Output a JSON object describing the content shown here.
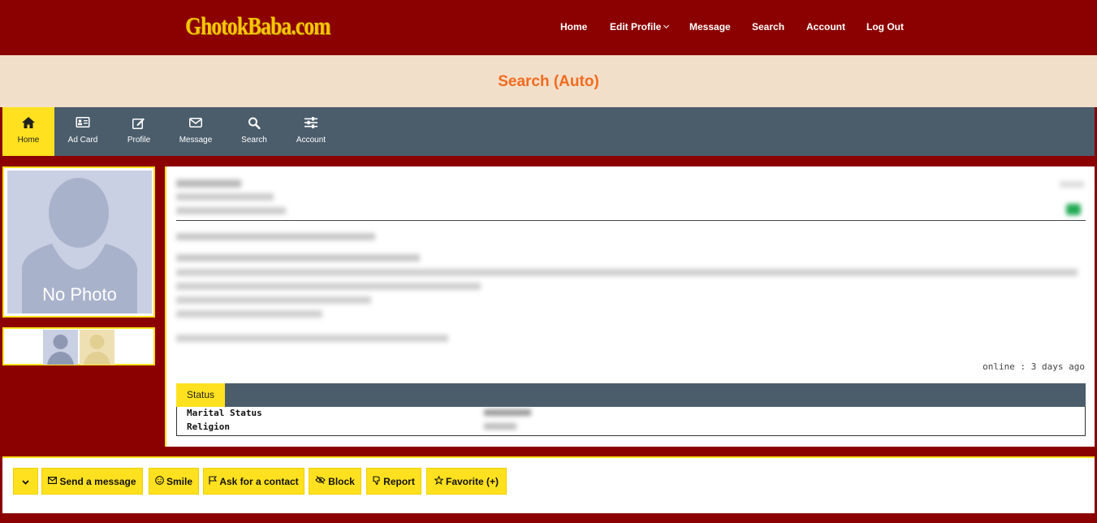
{
  "brand": {
    "logo": "GhotokBaba.com"
  },
  "nav": {
    "home": "Home",
    "edit_profile": "Edit Profile",
    "message": "Message",
    "search": "Search",
    "account": "Account",
    "logout": "Log Out"
  },
  "page": {
    "title": "Search (Auto)"
  },
  "menu": {
    "home": "Home",
    "ad_card": "Ad Card",
    "profile": "Profile",
    "message": "Message",
    "search": "Search",
    "account": "Account"
  },
  "photo": {
    "no_photo": "No Photo"
  },
  "profile": {
    "online": "online : 3 days ago"
  },
  "status": {
    "tab": "Status",
    "marital_label": "Marital Status",
    "religion_label": "Religion"
  },
  "actions": {
    "send_message": "Send a message",
    "smile": "Smile",
    "ask_contact": "Ask for a contact",
    "block": "Block",
    "report": "Report",
    "favorite": "Favorite (+)"
  },
  "colors": {
    "brand_red": "#8b0000",
    "accent_yellow": "#ffe11f",
    "menu_slate": "#4b5d6b",
    "title_orange": "#f26b1d",
    "band_beige": "#f2dfca"
  }
}
